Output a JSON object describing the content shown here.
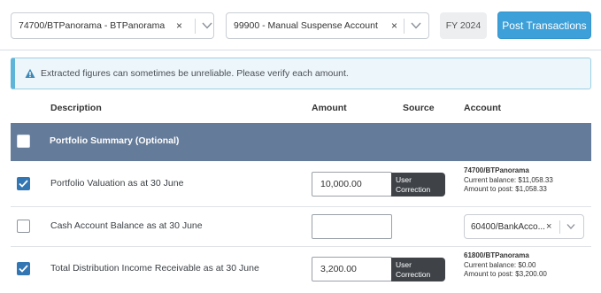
{
  "toolbar": {
    "select1_value": "74700/BTPanorama - BTPanorama",
    "select2_value": "99900 - Manual Suspense Account",
    "clear_glyph": "×",
    "fiscal_year": "FY 2024",
    "post_label": "Post Transactions"
  },
  "alert": {
    "message": "Extracted figures can sometimes be unreliable. Please verify each amount."
  },
  "table": {
    "headers": {
      "description": "Description",
      "amount": "Amount",
      "source": "Source",
      "account": "Account"
    },
    "group_label": "Portfolio Summary (Optional)",
    "rows": [
      {
        "checked": true,
        "description": "Portfolio Valuation as at 30 June",
        "amount": "10,000.00",
        "source_line1": "User",
        "source_line2": "Correction",
        "account_name": "74700/BTPanorama",
        "current_balance": "Current balance: $11,058.33",
        "amount_to_post": "Amount to post: $1,058.33"
      },
      {
        "checked": false,
        "description": "Cash Account Balance as at 30 June",
        "amount": "",
        "account_select": "60400/BankAcco..."
      },
      {
        "checked": true,
        "description": "Total Distribution Income Receivable as at 30 June",
        "amount": "3,200.00",
        "source_line1": "User",
        "source_line2": "Correction",
        "account_name": "61800/BTPanorama",
        "current_balance": "Current balance: $0.00",
        "amount_to_post": "Amount to post: $3,200.00"
      }
    ]
  },
  "icons": {
    "warning": "warning-triangle-icon",
    "chevron": "chevron-down-icon",
    "check": "checkmark-icon"
  },
  "colors": {
    "primary": "#3ea0d8",
    "group_band": "#647b9a",
    "checkbox_checked": "#3376b4",
    "correction_badge": "#3f4348",
    "alert_accent": "#5fb4da"
  }
}
